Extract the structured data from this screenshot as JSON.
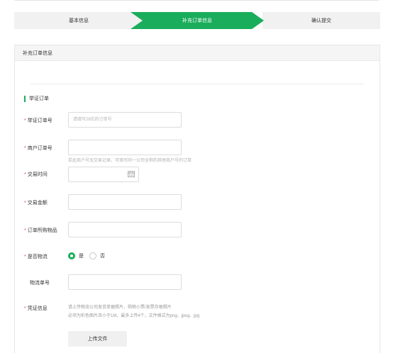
{
  "steps": [
    {
      "label": "基本信息",
      "active": false
    },
    {
      "label": "补充订单信息",
      "active": true
    },
    {
      "label": "确认提交",
      "active": false
    }
  ],
  "panel": {
    "title": "补充订单信息",
    "section_title": "举证订单"
  },
  "form": {
    "required_mark": "*",
    "order_no": {
      "label": "举证订单号",
      "placeholder": "请填写28位的订单号",
      "value": ""
    },
    "merchant_order_no": {
      "label": "商户订单号",
      "value": "",
      "hint": "若此商户号无交易记录，可填写同一公司全称的其他商户号的订单"
    },
    "trade_time": {
      "label": "交易时间",
      "value": "",
      "icon": "calendar-icon"
    },
    "trade_amount": {
      "label": "交易金额",
      "value": ""
    },
    "order_goods": {
      "label": "订单所购物品",
      "value": ""
    },
    "logistics": {
      "label": "是否物流",
      "options": [
        "是",
        "否"
      ],
      "selected": "是"
    },
    "tracking_no": {
      "label": "物流单号",
      "value": ""
    },
    "proof": {
      "label": "凭证信息",
      "info_line1": "请上传物流公司发货单据照片、购物小票/发票存根照片",
      "info_line2": "必须为彩色图片且小于1M，最多上传4个，文件格式为png、jpeg、jpg",
      "upload_label": "上传文件"
    }
  },
  "colors": {
    "accent": "#1aad5c",
    "required": "#e64340"
  }
}
